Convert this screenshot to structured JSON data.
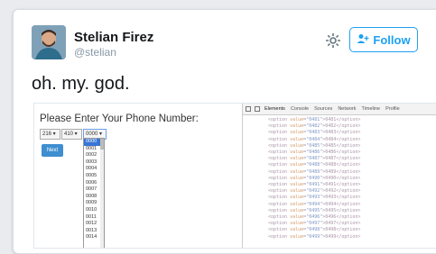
{
  "tweet": {
    "author_name": "Stelian Firez",
    "author_handle": "@stelian",
    "follow_label": "Follow",
    "text": "oh. my. god."
  },
  "embedded": {
    "prompt": "Please Enter Your Phone Number:",
    "select1": "216",
    "select2": "410",
    "select3": "0000",
    "next_label": "Next",
    "dropdown_options": [
      "0000",
      "0001",
      "0002",
      "0003",
      "0004",
      "0005",
      "0006",
      "0007",
      "0008",
      "0009",
      "0010",
      "0011",
      "0012",
      "0013",
      "0014"
    ],
    "devtools_tabs": [
      "Elements",
      "Console",
      "Sources",
      "Network",
      "Timeline",
      "Profile"
    ],
    "code_lines": [
      {
        "val": "0481",
        "text": "0481"
      },
      {
        "val": "0482",
        "text": "0482"
      },
      {
        "val": "0483",
        "text": "0483"
      },
      {
        "val": "0484",
        "text": "0484"
      },
      {
        "val": "0485",
        "text": "0485"
      },
      {
        "val": "0486",
        "text": "0486"
      },
      {
        "val": "0487",
        "text": "0487"
      },
      {
        "val": "0488",
        "text": "0488"
      },
      {
        "val": "0489",
        "text": "0489"
      },
      {
        "val": "0490",
        "text": "0490"
      },
      {
        "val": "0491",
        "text": "0491"
      },
      {
        "val": "0492",
        "text": "0492"
      },
      {
        "val": "0493",
        "text": "0493"
      },
      {
        "val": "0494",
        "text": "0494"
      },
      {
        "val": "0495",
        "text": "0495"
      },
      {
        "val": "0496",
        "text": "0496"
      },
      {
        "val": "0497",
        "text": "0497"
      },
      {
        "val": "0498",
        "text": "0498"
      },
      {
        "val": "0499",
        "text": "0499"
      }
    ]
  },
  "colors": {
    "accent": "#1da1f2",
    "next_button": "#3e8ed0",
    "selected_option": "#3875d7"
  }
}
